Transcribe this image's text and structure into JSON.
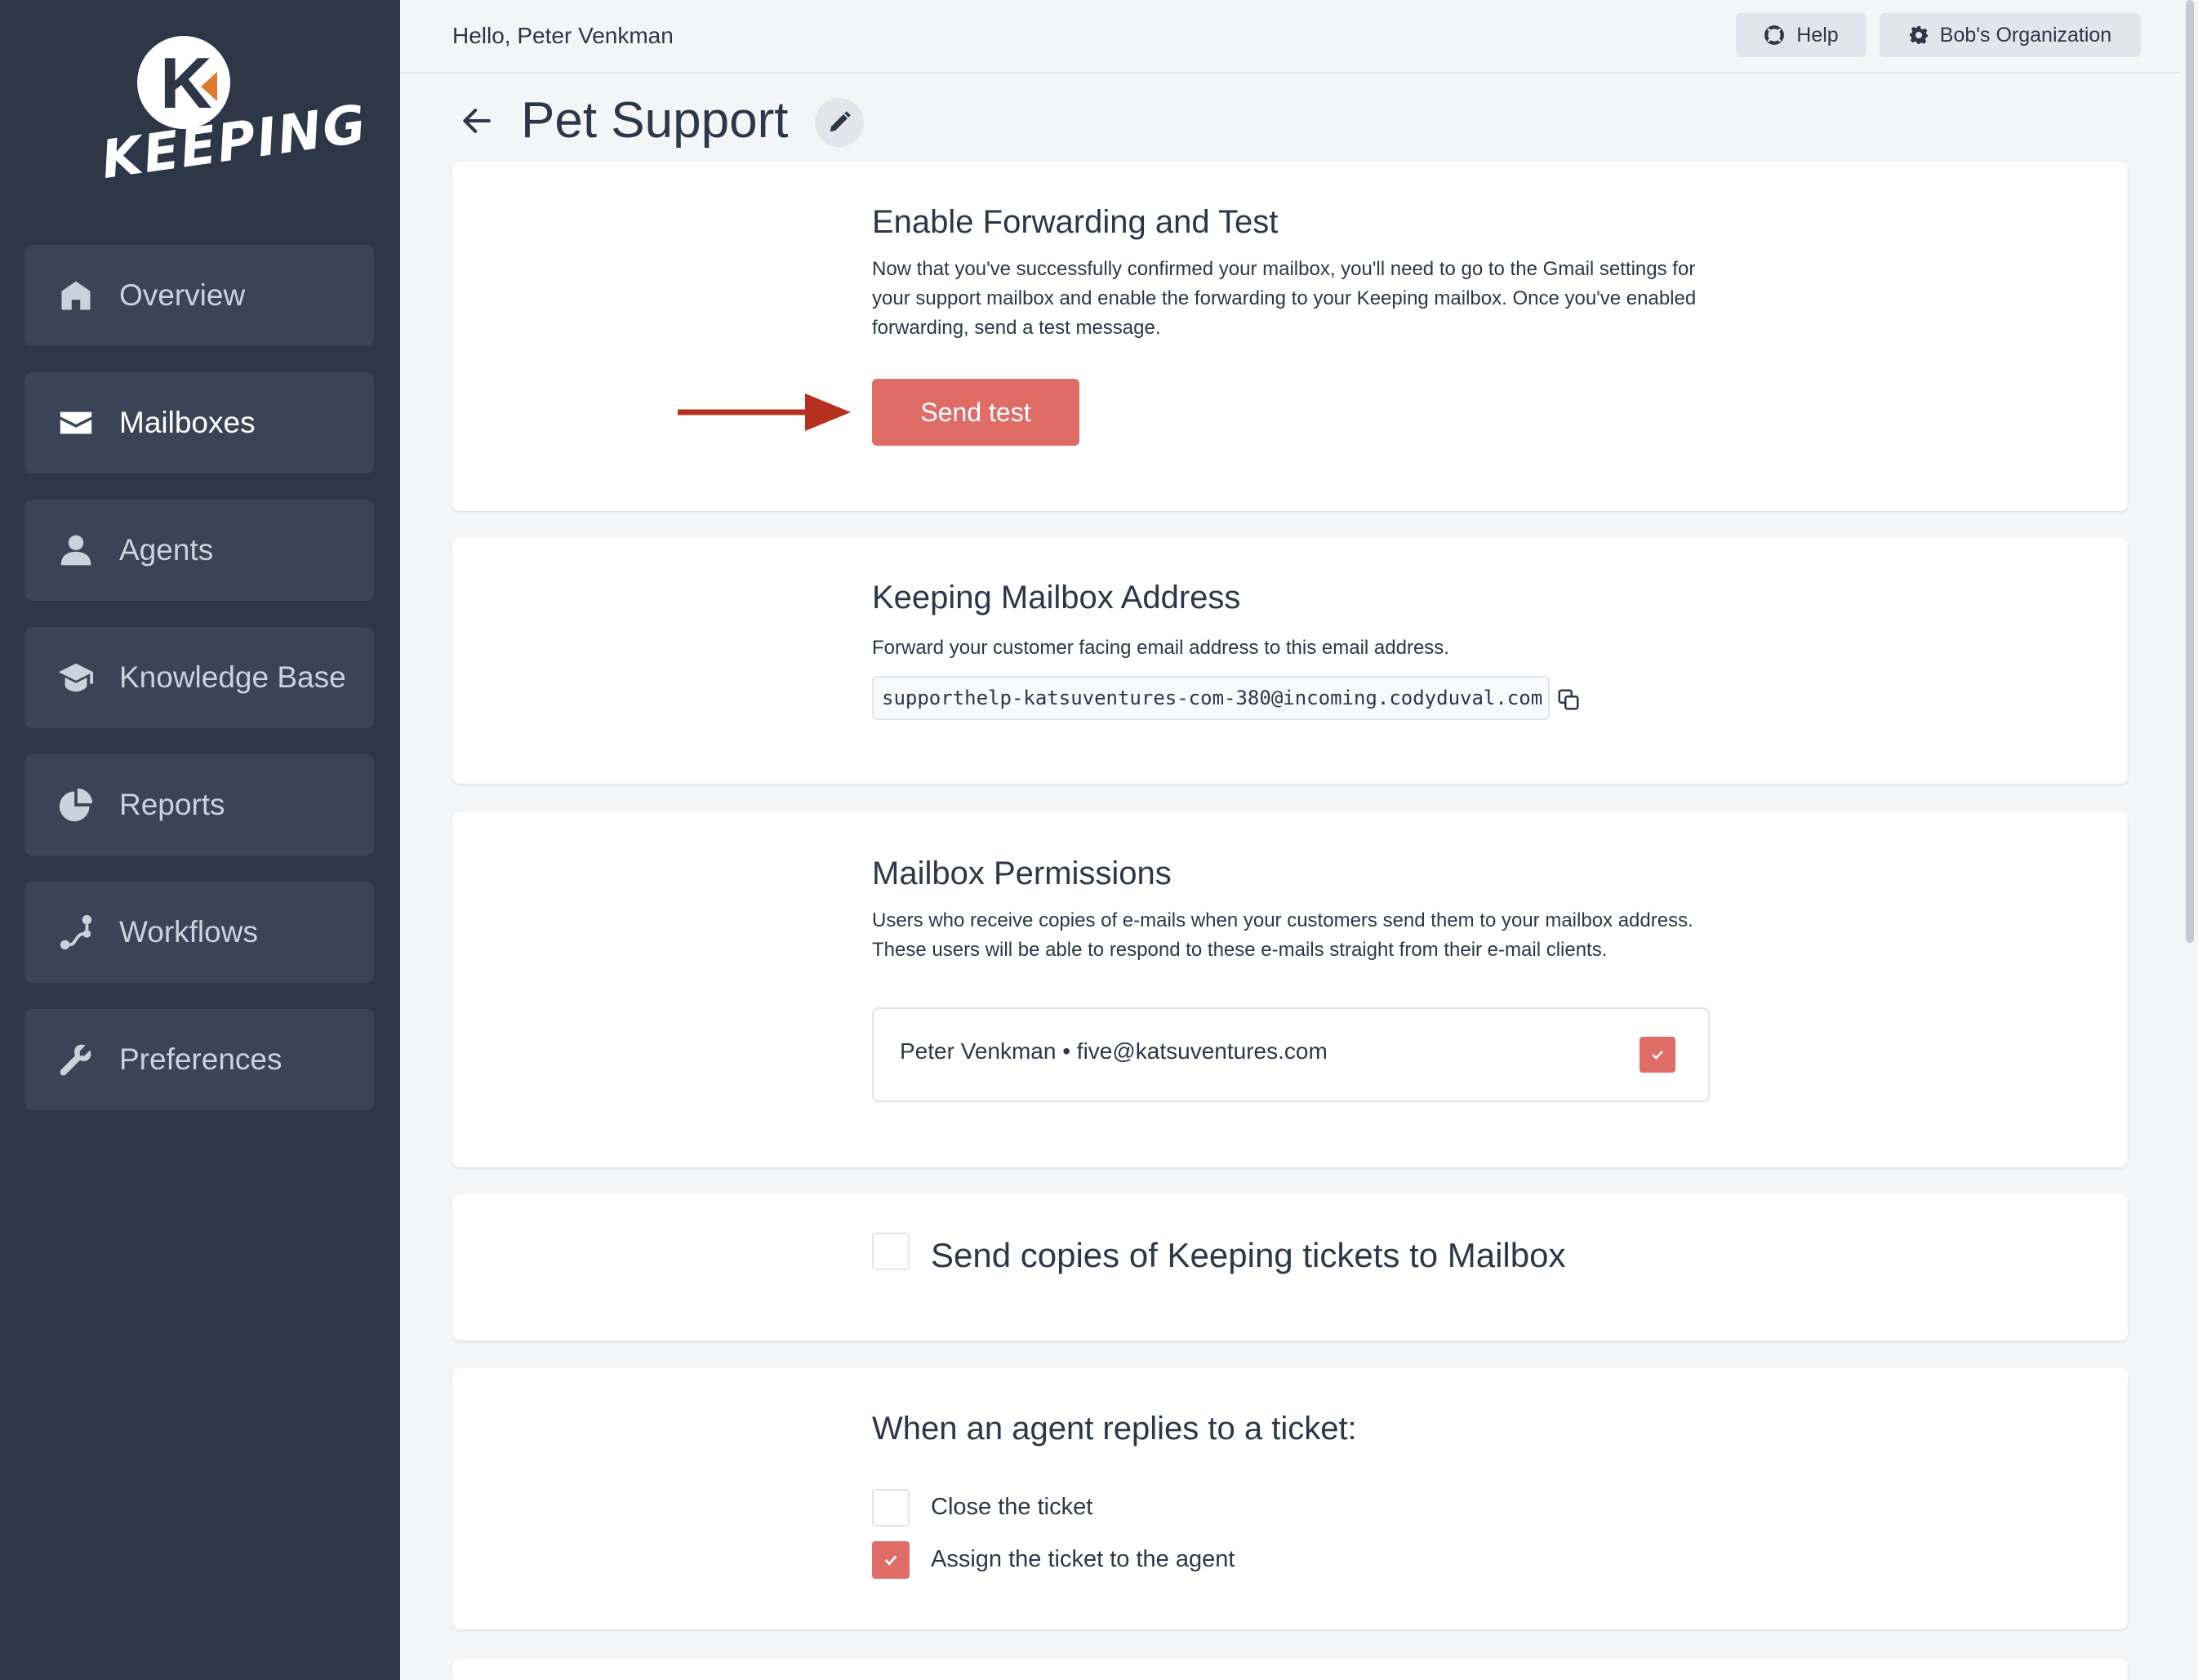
{
  "brand": {
    "logo_text": "KEEPING",
    "logo_letter": "K",
    "accent": "#e06c68",
    "sidebar_bg": "#2d3748"
  },
  "sidebar": {
    "items": [
      {
        "label": "Overview",
        "icon": "home-icon",
        "active": false
      },
      {
        "label": "Mailboxes",
        "icon": "envelope-icon",
        "active": true
      },
      {
        "label": "Agents",
        "icon": "user-icon",
        "active": false
      },
      {
        "label": "Knowledge Base",
        "icon": "graduation-cap-icon",
        "active": false
      },
      {
        "label": "Reports",
        "icon": "pie-chart-icon",
        "active": false
      },
      {
        "label": "Workflows",
        "icon": "workflow-icon",
        "active": false
      },
      {
        "label": "Preferences",
        "icon": "wrench-icon",
        "active": false
      }
    ]
  },
  "header": {
    "greeting": "Hello, Peter Venkman",
    "help_label": "Help",
    "org_label": "Bob's Organization"
  },
  "page": {
    "title": "Pet Support"
  },
  "forwarding": {
    "title": "Enable Forwarding and Test",
    "description": "Now that you've successfully confirmed your mailbox, you'll need to go to the Gmail settings for your support mailbox and enable the forwarding to your Keeping mailbox. Once you've enabled forwarding, send a test message.",
    "send_test_label": "Send test"
  },
  "mailbox_address": {
    "title": "Keeping Mailbox Address",
    "description": "Forward your customer facing email address to this email address.",
    "address": "supporthelp-katsuventures-com-380@incoming.codyduval.com"
  },
  "permissions": {
    "title": "Mailbox Permissions",
    "description": "Users who receive copies of e-mails when your customers send them to your mailbox address. These users will be able to respond to these e-mails straight from their e-mail clients.",
    "users": [
      {
        "label": "Peter Venkman • five@katsuventures.com",
        "checked": true
      }
    ]
  },
  "copies": {
    "label": "Send copies of Keeping tickets to Mailbox",
    "checked": false
  },
  "agent_reply": {
    "title": "When an agent replies to a ticket:",
    "options": [
      {
        "label": "Close the ticket",
        "checked": false
      },
      {
        "label": "Assign the ticket to the agent",
        "checked": true
      }
    ]
  }
}
